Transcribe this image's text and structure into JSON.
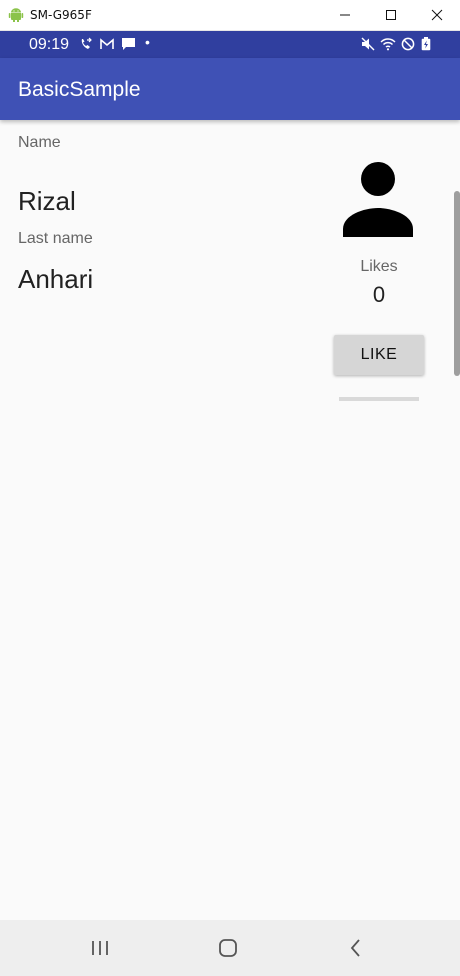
{
  "window": {
    "title": "SM-G965F",
    "icon": "android-icon"
  },
  "status_bar": {
    "time": "09:19",
    "dot": "•",
    "left_icons": [
      "call-forward-icon",
      "gmail-icon",
      "message-icon"
    ],
    "right_icons": [
      "mute-icon",
      "wifi-icon",
      "do-not-disturb-icon",
      "battery-icon"
    ]
  },
  "app_bar": {
    "title": "BasicSample"
  },
  "profile": {
    "name_label": "Name",
    "first_name": "Rizal",
    "last_name_label": "Last name",
    "last_name": "Anhari"
  },
  "likes": {
    "label": "Likes",
    "count": "0",
    "button_label": "LIKE"
  },
  "nav_bar": {
    "buttons": [
      "recents-icon",
      "home-icon",
      "back-icon"
    ]
  },
  "colors": {
    "status_bar": "#303f9f",
    "app_bar": "#3f51b5",
    "background": "#fafafa"
  }
}
